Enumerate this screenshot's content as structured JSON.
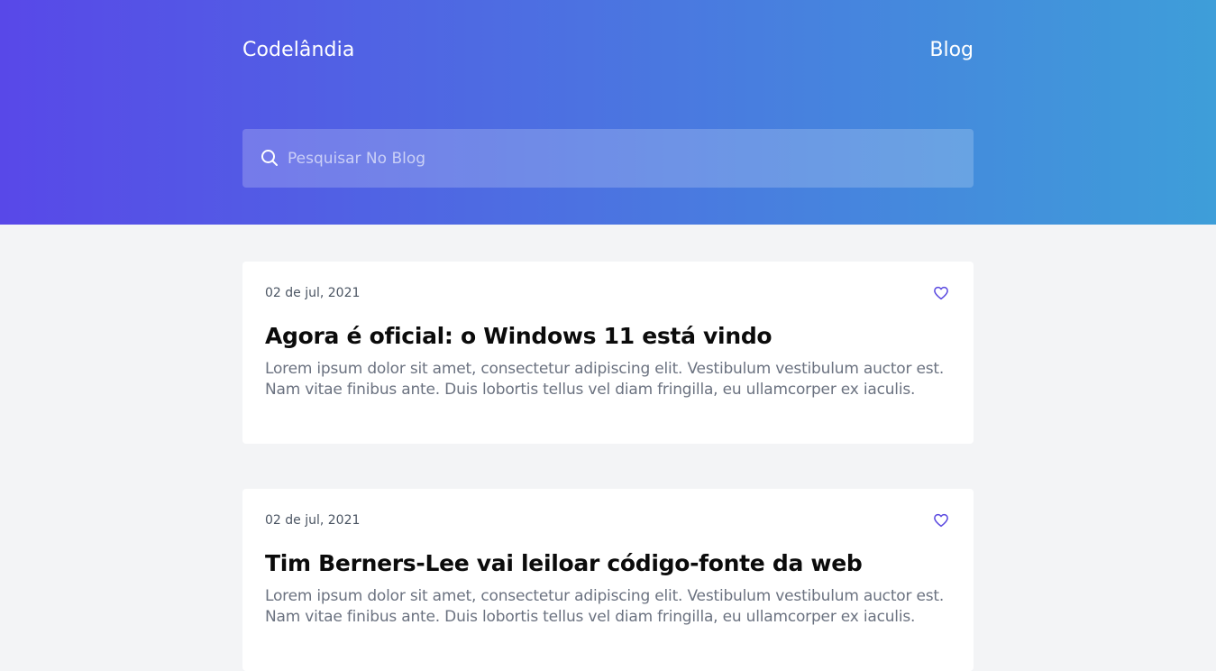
{
  "header": {
    "brand": "Codelândia",
    "nav_link": "Blog",
    "search_placeholder": "Pesquisar No Blog",
    "search_value": ""
  },
  "colors": {
    "gradient_start": "#5848e8",
    "gradient_end": "#3e9ed9",
    "accent": "#5b4ae0",
    "background": "#f3f4f6"
  },
  "posts": [
    {
      "date": "02 de jul, 2021",
      "title": "Agora é oficial: o Windows 11 está vindo",
      "excerpt": "Lorem ipsum dolor sit amet, consectetur adipiscing elit. Vestibulum vestibulum auctor est. Nam vitae finibus ante. Duis lobortis tellus vel diam fringilla, eu ullamcorper ex iaculis.",
      "like_icon": "heart-outline-icon"
    },
    {
      "date": "02 de jul, 2021",
      "title": "Tim Berners-Lee vai leiloar código-fonte da web",
      "excerpt": "Lorem ipsum dolor sit amet, consectetur adipiscing elit. Vestibulum vestibulum auctor est. Nam vitae finibus ante. Duis lobortis tellus vel diam fringilla, eu ullamcorper ex iaculis.",
      "like_icon": "heart-outline-icon"
    }
  ]
}
